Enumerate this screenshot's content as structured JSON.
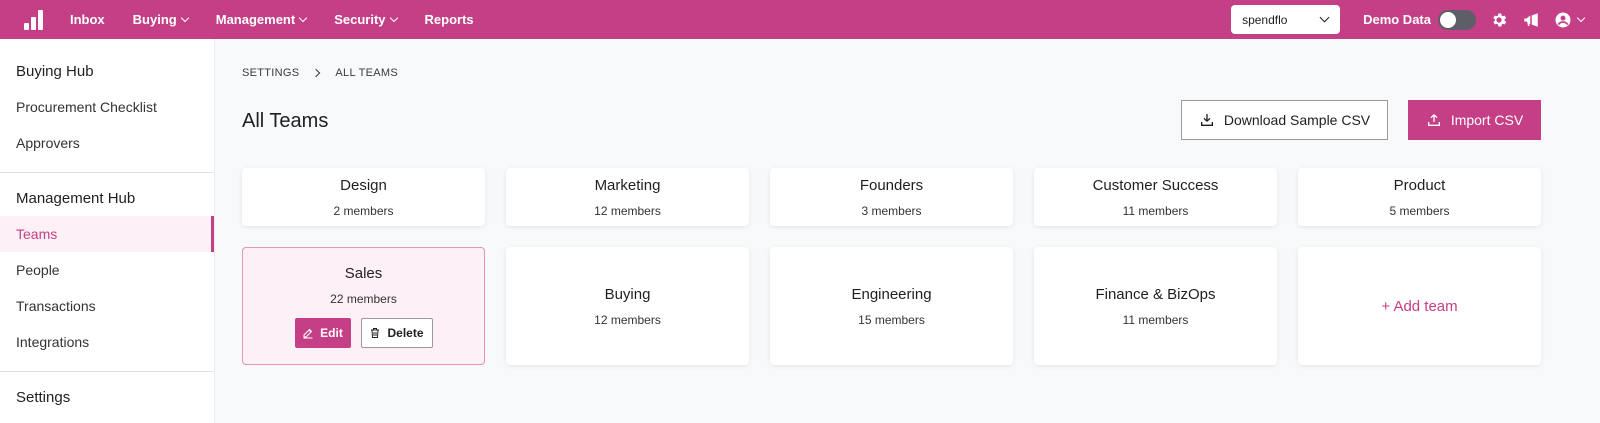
{
  "nav": {
    "items": [
      {
        "label": "Inbox",
        "dropdown": false
      },
      {
        "label": "Buying",
        "dropdown": true
      },
      {
        "label": "Management",
        "dropdown": true
      },
      {
        "label": "Security",
        "dropdown": true
      },
      {
        "label": "Reports",
        "dropdown": false
      }
    ],
    "org_select_value": "spendflo",
    "demo_label": "Demo Data",
    "demo_enabled": false,
    "icons": [
      "gear-icon",
      "megaphone-icon",
      "user-circle-icon"
    ]
  },
  "sidebar": {
    "buying_hub": {
      "title": "Buying Hub",
      "items": [
        "Procurement Checklist",
        "Approvers"
      ]
    },
    "management_hub": {
      "title": "Management Hub",
      "items": [
        "Teams",
        "People",
        "Transactions",
        "Integrations"
      ],
      "active": "Teams"
    },
    "settings": {
      "title": "Settings"
    }
  },
  "breadcrumb": {
    "root": "SETTINGS",
    "current": "ALL TEAMS"
  },
  "page": {
    "title": "All Teams",
    "download_label": "Download Sample CSV",
    "import_label": "Import CSV"
  },
  "teams": [
    {
      "name": "Design",
      "members": "2 members"
    },
    {
      "name": "Marketing",
      "members": "12 members"
    },
    {
      "name": "Founders",
      "members": "3 members"
    },
    {
      "name": "Customer Success",
      "members": "11 members"
    },
    {
      "name": "Product",
      "members": "5 members"
    },
    {
      "name": "Sales",
      "members": "22 members"
    },
    {
      "name": "Buying",
      "members": "12 members"
    },
    {
      "name": "Engineering",
      "members": "15 members"
    },
    {
      "name": "Finance & BizOps",
      "members": "11 members"
    }
  ],
  "selected_team": {
    "edit_label": "Edit",
    "delete_label": "Delete"
  },
  "add_team_label": "+ Add team",
  "colors": {
    "brand": "#c43f86",
    "selected_bg": "#fdf0f6"
  }
}
